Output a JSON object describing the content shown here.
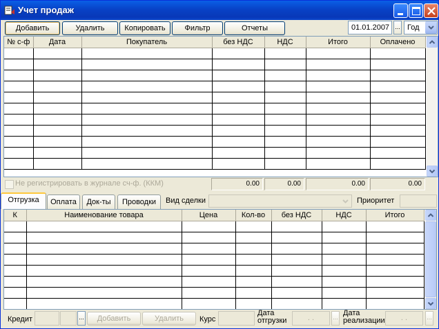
{
  "window": {
    "title": "Учет продаж"
  },
  "toolbar": {
    "add": "Добавить",
    "delete": "Удалить",
    "copy": "Копировать",
    "filter": "Фильтр",
    "reports": "Отчеты",
    "date_value": "01.01.2007",
    "date_button": "...",
    "period_value": "Год"
  },
  "invoices": {
    "columns": [
      "№ с-ф",
      "Дата",
      "Покупатель",
      "без НДС",
      "НДС",
      "Итого",
      "Оплачено"
    ],
    "rows": [
      [],
      [],
      [],
      [],
      [],
      [],
      [],
      [],
      [],
      [],
      []
    ]
  },
  "no_register": {
    "label": "Не регистрировать в журнале сч-ф. (ККМ)"
  },
  "totals": {
    "net": "0.00",
    "vat": "0.00",
    "total": "0.00",
    "paid": "0.00"
  },
  "tabs": [
    "Отгрузка",
    "Оплата",
    "Док-ты",
    "Проводки"
  ],
  "deal_type": {
    "label": "Вид сделки",
    "value": ""
  },
  "priority": {
    "label": "Приоритет",
    "value": ""
  },
  "goods": {
    "columns": [
      "К",
      "Наименование товара",
      "Цена",
      "Кол-во",
      "без НДС",
      "НДС",
      "Итого"
    ],
    "rows": [
      [],
      [],
      [],
      [],
      [],
      [],
      [],
      []
    ]
  },
  "bottom": {
    "credit_label": "Кредит",
    "ellipsis": "...",
    "add": "Добавить",
    "delete": "Удалить",
    "rate_label": "Курс",
    "ship_date_label_1": "Дата",
    "ship_date_label_2": "отгрузки",
    "ship_date_value": ". .",
    "sale_date_label_1": "Дата",
    "sale_date_label_2": "реализации",
    "sale_date_value": ". ."
  },
  "colors": {
    "titlebar": "#0842c6",
    "window_bg": "#ece9d8",
    "grid_border": "#7f9db9"
  }
}
